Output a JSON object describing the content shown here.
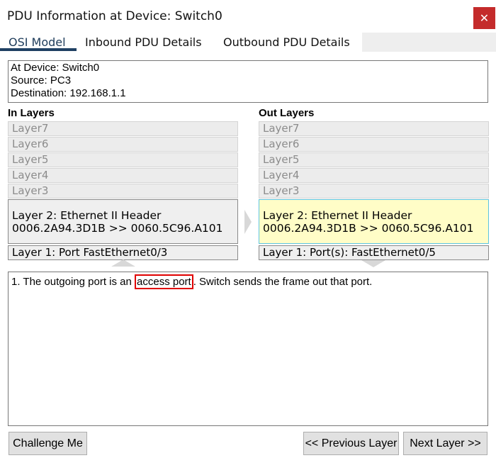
{
  "window": {
    "title": "PDU Information at Device: Switch0",
    "close_glyph": "✕"
  },
  "tabs": [
    {
      "label": "OSI Model",
      "active": true
    },
    {
      "label": "Inbound PDU Details",
      "active": false
    },
    {
      "label": "Outbound PDU Details",
      "active": false
    }
  ],
  "info": {
    "device": "At Device: Switch0",
    "source": "Source: PC3",
    "destination": "Destination: 192.168.1.1"
  },
  "in_layers": {
    "title": "In Layers",
    "inactive": [
      "Layer7",
      "Layer6",
      "Layer5",
      "Layer4",
      "Layer3"
    ],
    "layer2_line1": "Layer 2: Ethernet II Header",
    "layer2_line2": "0006.2A94.3D1B >> 0060.5C96.A101",
    "layer1": "Layer 1: Port FastEthernet0/3"
  },
  "out_layers": {
    "title": "Out Layers",
    "inactive": [
      "Layer7",
      "Layer6",
      "Layer5",
      "Layer4",
      "Layer3"
    ],
    "layer2_line1": "Layer 2: Ethernet II Header",
    "layer2_line2": "0006.2A94.3D1B >> 0060.5C96.A101",
    "layer1": "Layer 1: Port(s): FastEthernet0/5"
  },
  "description": {
    "before": "1. The outgoing port is an ",
    "highlight": "access port",
    "after": ". Switch sends the frame out that port."
  },
  "buttons": {
    "challenge": "Challenge Me",
    "previous": "<< Previous Layer",
    "next": "Next Layer >>"
  },
  "colors": {
    "close_bg": "#c42b2b",
    "active_tab_underline": "#1f4063",
    "selected_layer_bg": "#fffdc7",
    "selected_layer_border": "#5cc4e0",
    "highlight_outline": "#e00000"
  }
}
